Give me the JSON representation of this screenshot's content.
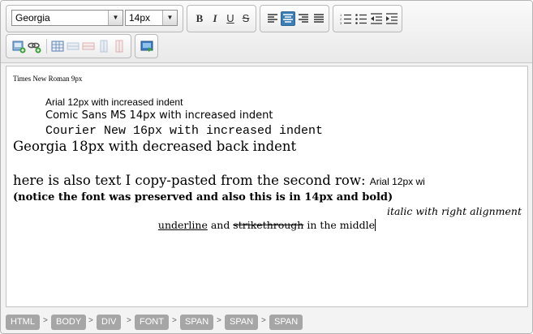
{
  "toolbar": {
    "font_family": "Georgia",
    "font_size": "14px",
    "bold_label": "B",
    "italic_label": "I",
    "underline_label": "U",
    "strike_label": "S",
    "active_alignment": "align-left",
    "icons": [
      "insert-image-icon",
      "insert-link-icon",
      "insert-table-icon",
      "table-row-icon",
      "table-delete-row-icon",
      "table-column-icon",
      "table-delete-column-icon",
      "insert-media-icon"
    ]
  },
  "content": {
    "lines": [
      "Times New Roman 9px",
      "Arial 12px with increased indent",
      "Comic Sans MS 14px with increased indent",
      "Courier New 16px with increased indent",
      "Georgia 18px with decreased back indent",
      "here is also text I copy-pasted from the second row:",
      "Arial 12px wi",
      "(notice the font was preserved and also this is in 14px and bold)",
      "italic with right alignment",
      "underline",
      " and ",
      "strikethrough",
      " in the middle"
    ]
  },
  "statusbar": {
    "path": [
      "HTML",
      "BODY",
      "DIV",
      "FONT",
      "SPAN",
      "SPAN",
      "SPAN"
    ],
    "separator": ">"
  }
}
